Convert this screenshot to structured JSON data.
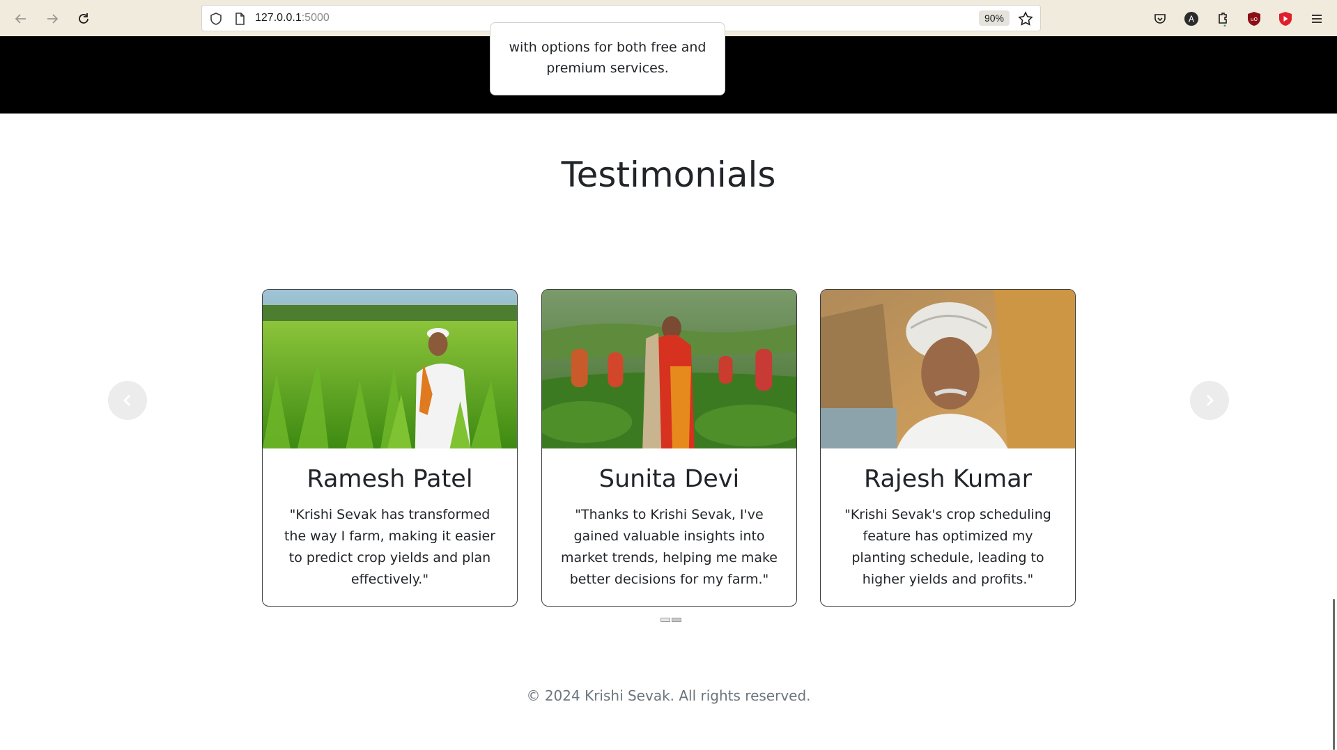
{
  "browser": {
    "url_host": "127.0.0.1",
    "url_port": ":5000",
    "zoom": "90%",
    "extensions": [
      "pocket-icon",
      "account-icon",
      "extensions-icon",
      "ublock-icon",
      "video-blocker-icon",
      "menu-icon"
    ]
  },
  "services": {
    "partial_card_text_line1": "with options for both free and",
    "partial_card_text_line2": "premium services."
  },
  "testimonials": {
    "title": "Testimonials",
    "cards": [
      {
        "name": "Ramesh Patel",
        "quote": "\"Krishi Sevak has transformed the way I farm, making it easier to predict crop yields and plan effectively.\""
      },
      {
        "name": "Sunita Devi",
        "quote": "\"Thanks to Krishi Sevak, I've gained valuable insights into market trends, helping me make better decisions for my farm.\""
      },
      {
        "name": "Rajesh Kumar",
        "quote": "\"Krishi Sevak's crop scheduling feature has optimized my planting schedule, leading to higher yields and profits.\""
      }
    ],
    "prev_label": "Previous",
    "next_label": "Next",
    "indicator_count": 2,
    "active_indicator": 1
  },
  "footer": {
    "copyright": "© 2024 Krishi Sevak. All rights reserved."
  }
}
